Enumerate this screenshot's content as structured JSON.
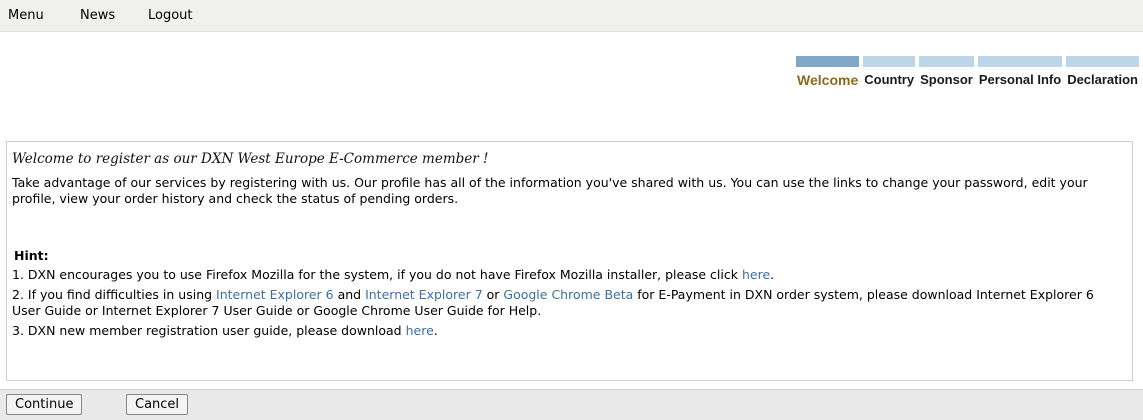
{
  "nav": {
    "menu": "Menu",
    "news": "News",
    "logout": "Logout"
  },
  "steps": [
    {
      "label": "Welcome",
      "active": true
    },
    {
      "label": "Country",
      "active": false
    },
    {
      "label": "Sponsor",
      "active": false
    },
    {
      "label": "Personal Info",
      "active": false
    },
    {
      "label": "Declaration",
      "active": false
    }
  ],
  "content": {
    "welcome": "Welcome to register as our DXN West Europe E-Commerce member !",
    "intro": "Take advantage of our services by registering with us. Our profile has all of the information you've shared with us. You can use the links to change your password, edit your profile, view your order history and check the status of pending orders.",
    "hint_title": "Hint:",
    "hint1": {
      "text": "1. DXN encourages you to use Firefox Mozilla for the system, if you do not have Firefox Mozilla installer, please click ",
      "link": "here",
      "end": "."
    },
    "hint2": {
      "prefix": "2. If you find difficulties in using ",
      "link_ie6": "Internet Explorer 6",
      "and": " and ",
      "link_ie7": "Internet Explorer 7",
      "or": " or ",
      "link_chrome": "Google Chrome Beta",
      "suffix": " for E-Payment in DXN order system, please download Internet Explorer 6 User Guide or Internet Explorer 7 User Guide or Google Chrome User Guide for Help."
    },
    "hint3": {
      "text": "3. DXN new member registration user guide, please download ",
      "link": "here",
      "end": "."
    }
  },
  "buttons": {
    "continue": "Continue",
    "cancel": "Cancel"
  },
  "colors": {
    "link": "#3f6fa2",
    "step_active_text": "#8a6a1e",
    "step_bar_active": "#7ea7c8",
    "step_bar": "#bcd6e8"
  }
}
